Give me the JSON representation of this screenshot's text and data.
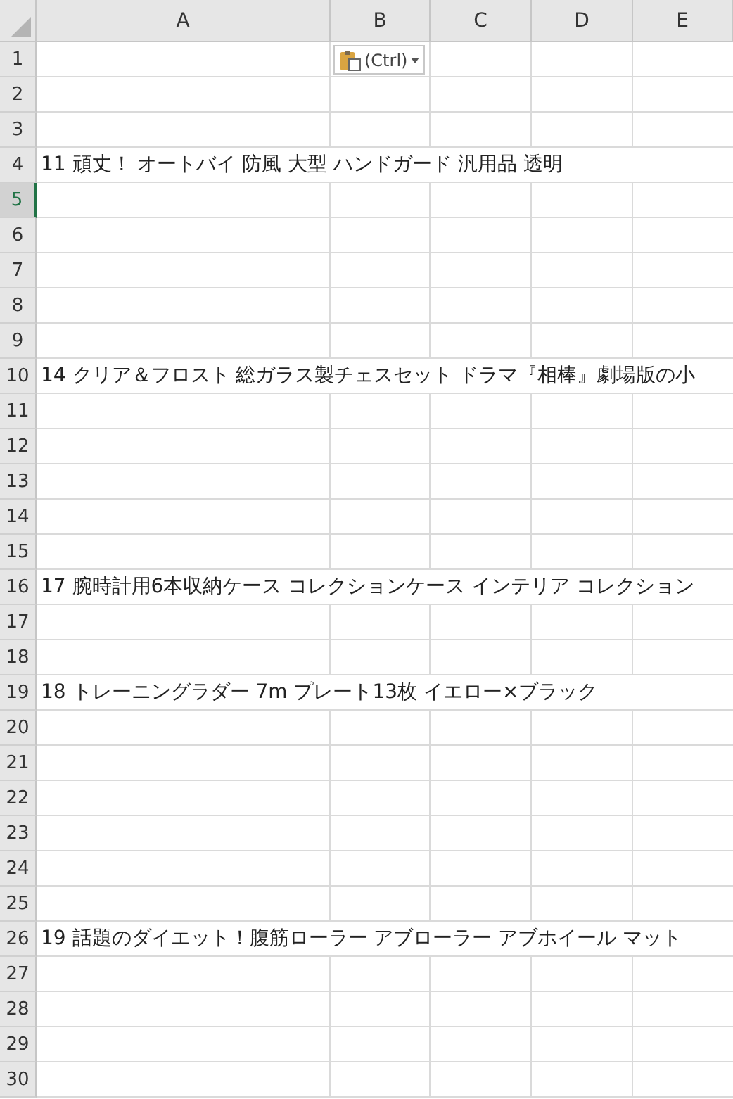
{
  "columns": [
    "A",
    "B",
    "C",
    "D",
    "E"
  ],
  "paste_options": {
    "label": "(Ctrl)"
  },
  "rows": [
    {
      "number": "1",
      "selected": false
    },
    {
      "number": "2",
      "selected": false
    },
    {
      "number": "3",
      "selected": false
    },
    {
      "number": "4",
      "selected": false,
      "text": "11 頑丈！ オートバイ 防風 大型 ハンドガード 汎用品 透明"
    },
    {
      "number": "5",
      "selected": true
    },
    {
      "number": "6",
      "selected": false
    },
    {
      "number": "7",
      "selected": false
    },
    {
      "number": "8",
      "selected": false
    },
    {
      "number": "9",
      "selected": false
    },
    {
      "number": "10",
      "selected": false,
      "text": "14 クリア＆フロスト 総ガラス製チェスセット ドラマ『相棒』劇場版の小"
    },
    {
      "number": "11",
      "selected": false
    },
    {
      "number": "12",
      "selected": false
    },
    {
      "number": "13",
      "selected": false
    },
    {
      "number": "14",
      "selected": false
    },
    {
      "number": "15",
      "selected": false
    },
    {
      "number": "16",
      "selected": false,
      "text": "17 腕時計用6本収納ケース コレクションケース インテリア コレクション"
    },
    {
      "number": "17",
      "selected": false
    },
    {
      "number": "18",
      "selected": false
    },
    {
      "number": "19",
      "selected": false,
      "text": "18 トレーニングラダー 7m プレート13枚 イエロー×ブラック"
    },
    {
      "number": "20",
      "selected": false
    },
    {
      "number": "21",
      "selected": false
    },
    {
      "number": "22",
      "selected": false
    },
    {
      "number": "23",
      "selected": false
    },
    {
      "number": "24",
      "selected": false
    },
    {
      "number": "25",
      "selected": false
    },
    {
      "number": "26",
      "selected": false,
      "text": "19 話題のダイエット！腹筋ローラー アブローラー アブホイール マット"
    },
    {
      "number": "27",
      "selected": false
    },
    {
      "number": "28",
      "selected": false
    },
    {
      "number": "29",
      "selected": false
    },
    {
      "number": "30",
      "selected": false
    }
  ]
}
